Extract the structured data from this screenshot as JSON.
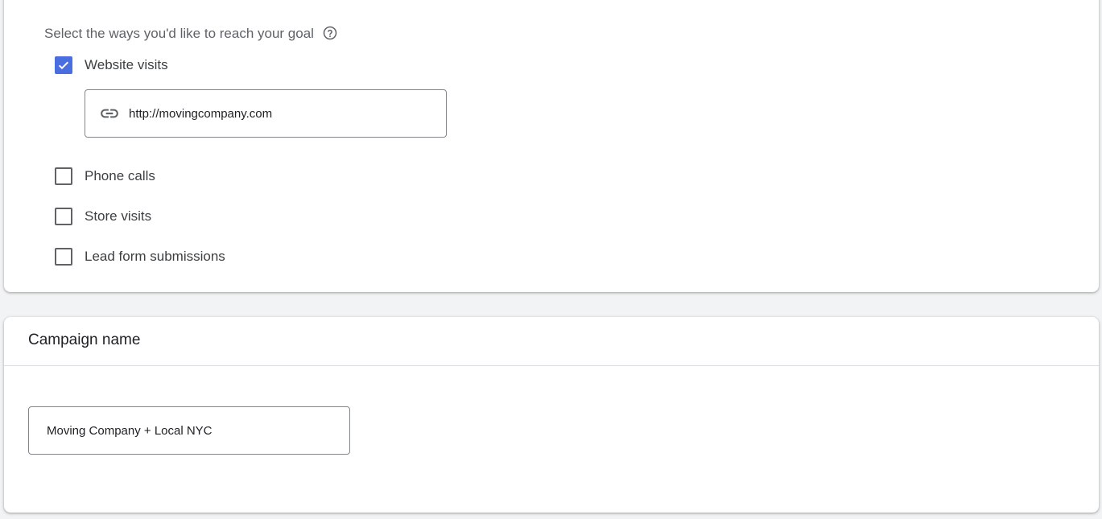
{
  "goal_section": {
    "heading": "Select the ways you'd like to reach your goal",
    "help_icon": "help-circle-icon",
    "options": [
      {
        "label": "Website visits",
        "checked": true
      },
      {
        "label": "Phone calls",
        "checked": false
      },
      {
        "label": "Store visits",
        "checked": false
      },
      {
        "label": "Lead form submissions",
        "checked": false
      }
    ],
    "website_url": {
      "icon": "link-icon",
      "value": "http://movingcompany.com"
    }
  },
  "campaign_section": {
    "title": "Campaign name",
    "name_value": "Moving Company + Local NYC"
  },
  "colors": {
    "accent": "#4a6ee0",
    "background": "#f1f3f4",
    "card": "#ffffff",
    "border": "#80868b"
  }
}
